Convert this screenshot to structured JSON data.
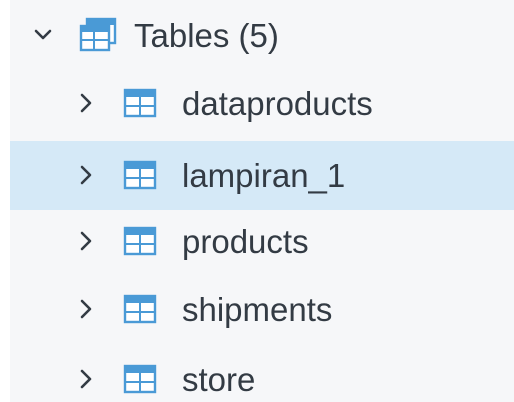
{
  "tree": {
    "root": {
      "label": "Tables (5)",
      "expanded": true
    },
    "items": [
      {
        "label": "dataproducts",
        "selected": false
      },
      {
        "label": "lampiran_1",
        "selected": true
      },
      {
        "label": "products",
        "selected": false
      },
      {
        "label": "shipments",
        "selected": false
      },
      {
        "label": "store",
        "selected": false
      }
    ]
  },
  "colors": {
    "selection": "#d5e9f7",
    "icon": "#4a9ad6",
    "text": "#333b44"
  }
}
